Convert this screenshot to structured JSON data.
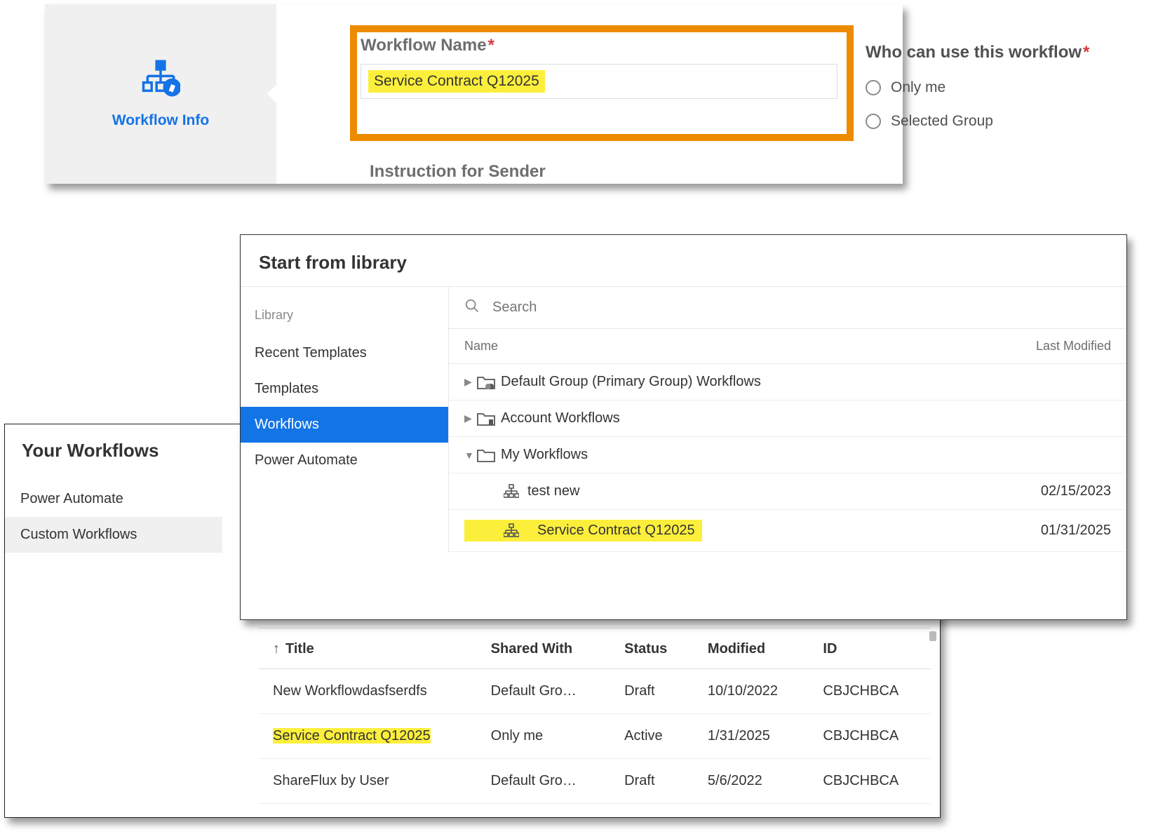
{
  "panel1": {
    "tab_label": "Workflow Info",
    "workflow_name_label": "Workflow Name",
    "workflow_name_value": "Service Contract Q12025",
    "instruction_label": "Instruction for Sender",
    "who_label": "Who can use this workflow",
    "who_options": [
      "Only me",
      "Selected Group"
    ]
  },
  "panel2": {
    "title": "Start from library",
    "search_placeholder": "Search",
    "nav_group": "Library",
    "nav_items": [
      "Recent Templates",
      "Templates",
      "Workflows",
      "Power Automate"
    ],
    "nav_selected_index": 2,
    "col_name": "Name",
    "col_modified": "Last Modified",
    "folders": [
      {
        "name": "Default Group (Primary Group) Workflows",
        "type": "group"
      },
      {
        "name": "Account Workflows",
        "type": "account"
      },
      {
        "name": "My Workflows",
        "type": "plain",
        "expanded": true
      }
    ],
    "items": [
      {
        "name": "test new",
        "date": "02/15/2023",
        "highlight": false
      },
      {
        "name": "Service Contract Q12025",
        "date": "01/31/2025",
        "highlight": true
      }
    ]
  },
  "panel3": {
    "title": "Your Workflows",
    "nav_items": [
      "Power Automate",
      "Custom Workflows"
    ],
    "nav_selected_index": 1,
    "columns": [
      "Title",
      "Shared With",
      "Status",
      "Modified",
      "ID"
    ],
    "rows": [
      {
        "title": "New Workflowdasfserdfs",
        "shared": "Default Gro…",
        "status": "Draft",
        "modified": "10/10/2022",
        "id": "CBJCHBCA",
        "highlight": false
      },
      {
        "title": "Service Contract Q12025",
        "shared": "Only me",
        "status": "Active",
        "modified": "1/31/2025",
        "id": "CBJCHBCA",
        "highlight": true
      },
      {
        "title": "ShareFlux by User",
        "shared": "Default Gro…",
        "status": "Draft",
        "modified": "5/6/2022",
        "id": "CBJCHBCA",
        "highlight": false
      }
    ]
  }
}
